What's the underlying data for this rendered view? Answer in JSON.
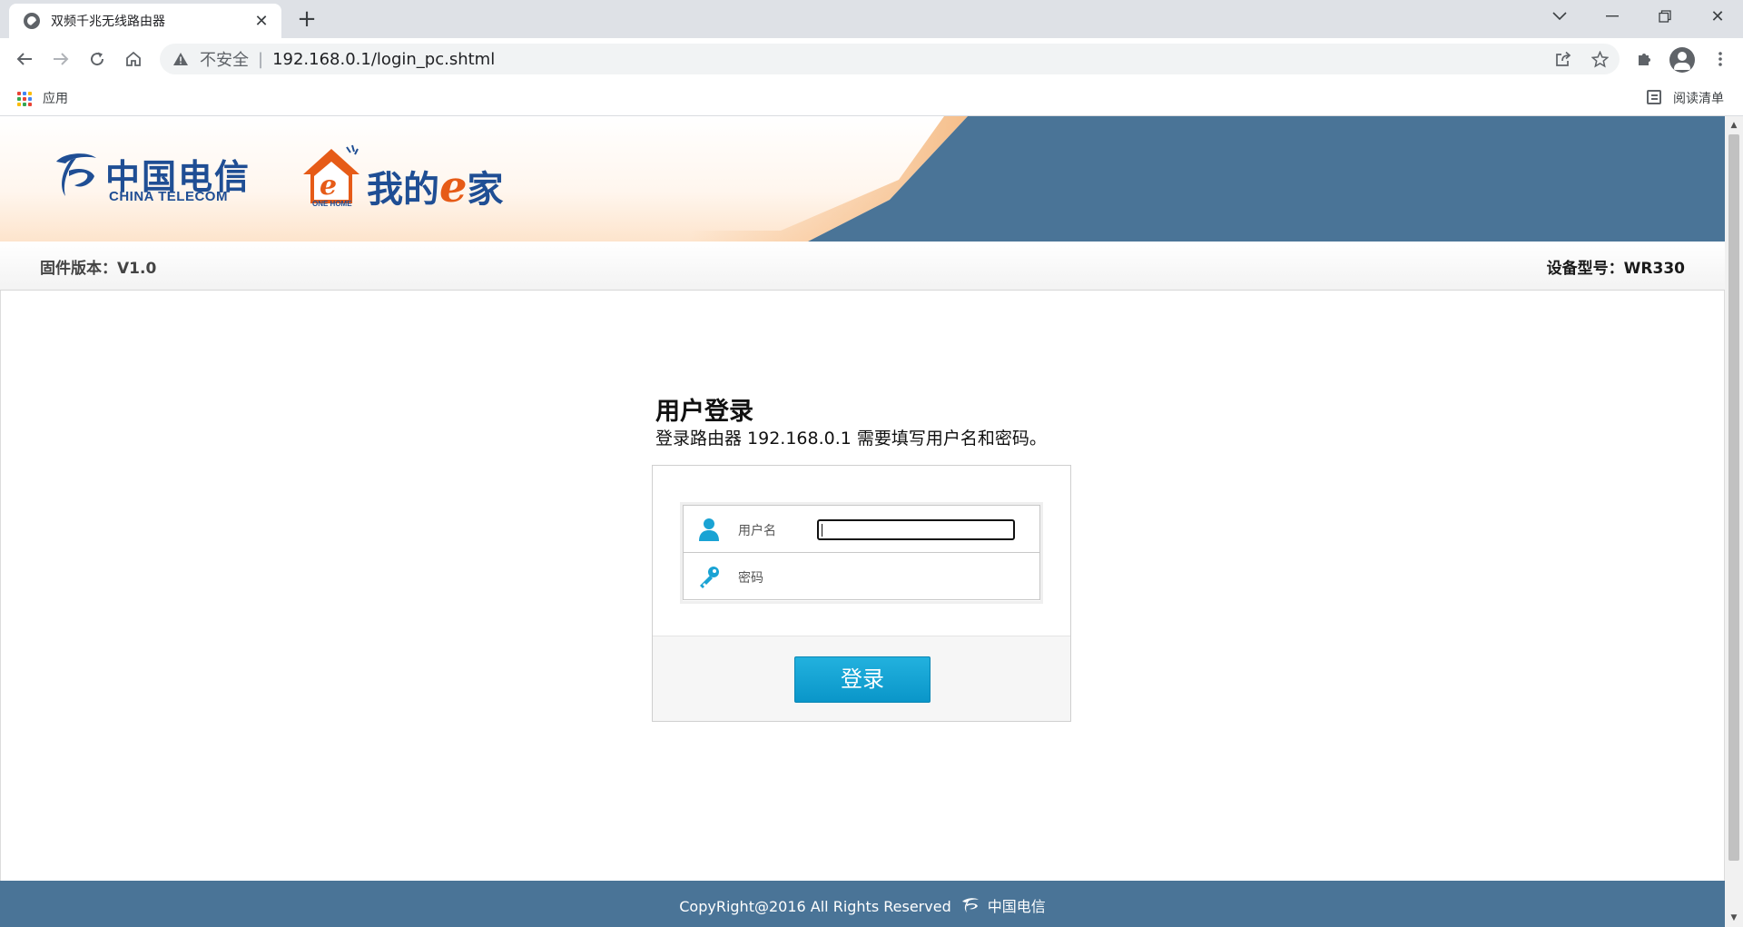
{
  "browser": {
    "tab_title": "双频千兆无线路由器",
    "security_label": "不安全",
    "url": "192.168.0.1/login_pc.shtml",
    "bookmarks": {
      "apps_label": "应用",
      "reading_list_label": "阅读清单"
    }
  },
  "header": {
    "brand_cn": "中国电信",
    "brand_en": "CHINA TELECOM",
    "ehome_before": "我的",
    "ehome_e": "e",
    "ehome_after": "家",
    "ehome_small": "ONE HOME",
    "firmware": "固件版本：V1.0",
    "model": "设备型号：WR330"
  },
  "login": {
    "heading": "用户登录",
    "description": "登录路由器 192.168.0.1 需要填写用户名和密码。",
    "username_label": "用户名",
    "username_value": "",
    "password_label": "密码",
    "password_value": "",
    "submit_label": "登录"
  },
  "footer": {
    "copyright": "CopyRight@2016 All Rights Reserved",
    "brand": "中国电信"
  },
  "colors": {
    "header_blue": "#4a7497",
    "banner_orange": "#f2a760",
    "button_blue": "#0a96c9",
    "brand_blue": "#1f4e94",
    "ehome_orange": "#e65b17"
  }
}
